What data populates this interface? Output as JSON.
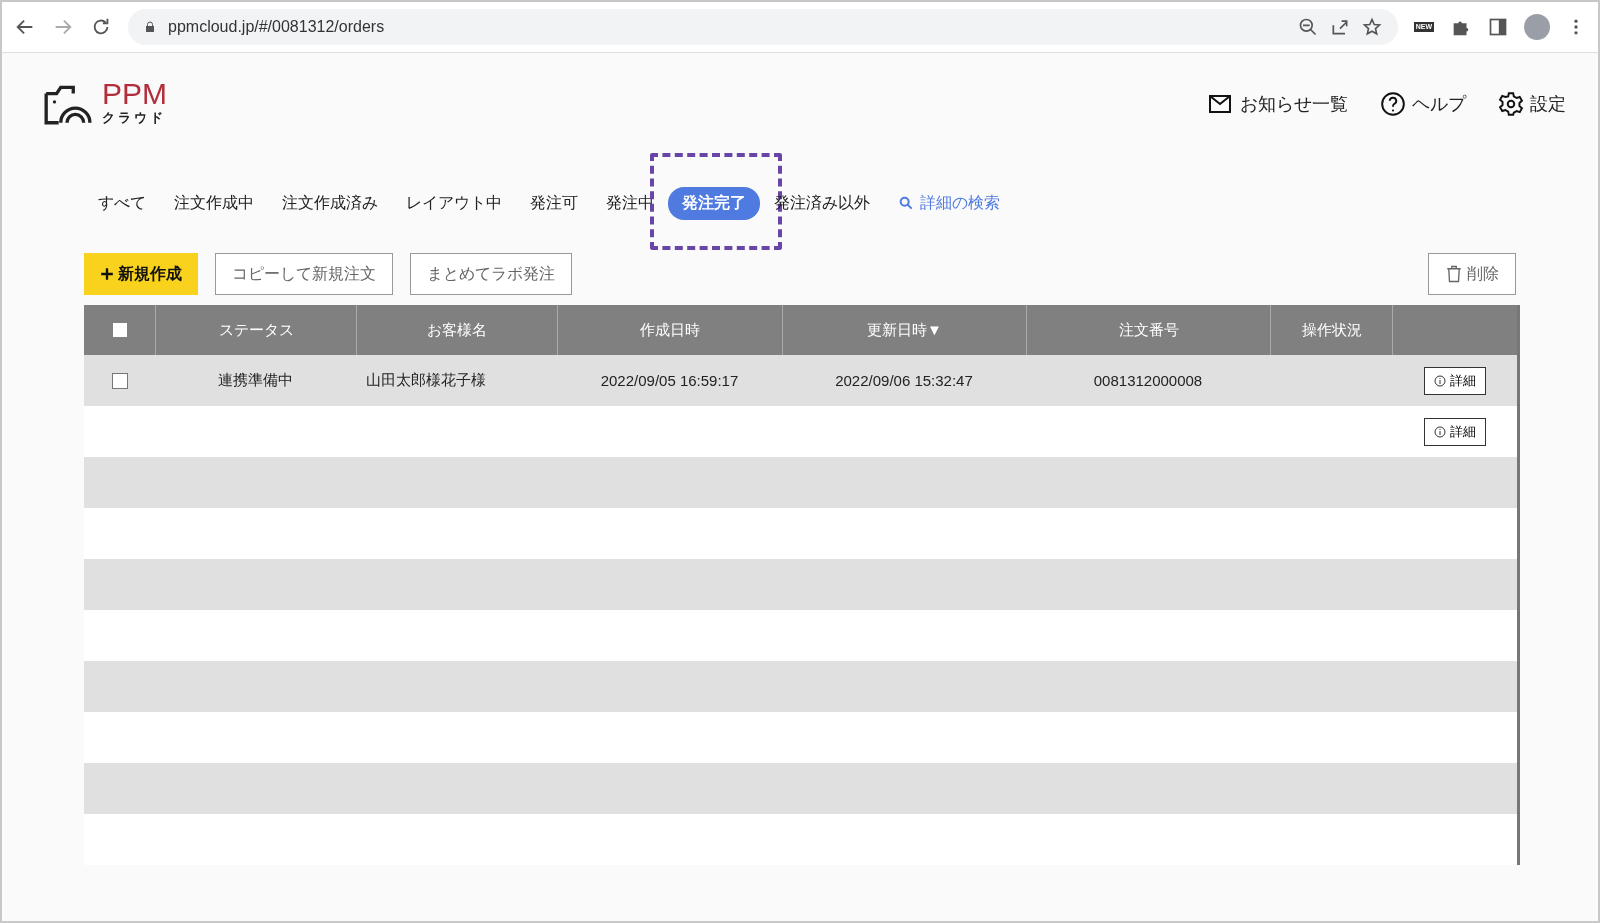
{
  "browser": {
    "url": "ppmcloud.jp/#/0081312/orders",
    "extension_badge": "NEW"
  },
  "header": {
    "logo_text": "PPM",
    "logo_subtext": "クラウド",
    "links": [
      {
        "kind": "mail",
        "label": "お知らせ一覧"
      },
      {
        "kind": "help",
        "label": "ヘルプ"
      },
      {
        "kind": "settings",
        "label": "設定"
      }
    ]
  },
  "tabs": [
    {
      "label": "すべて",
      "selected": false,
      "highlighted": false
    },
    {
      "label": "注文作成中",
      "selected": false,
      "highlighted": false
    },
    {
      "label": "注文作成済み",
      "selected": false,
      "highlighted": false
    },
    {
      "label": "レイアウト中",
      "selected": false,
      "highlighted": false
    },
    {
      "label": "発注可",
      "selected": false,
      "highlighted": false
    },
    {
      "label": "発注中",
      "selected": false,
      "highlighted": false
    },
    {
      "label": "発注完了",
      "selected": true,
      "highlighted": true
    },
    {
      "label": "発注済み以外",
      "selected": false,
      "highlighted": false
    }
  ],
  "search_link": "詳細の検索",
  "toolbar": {
    "buttons": [
      {
        "kind": "primary",
        "label": "新規作成"
      },
      {
        "kind": "outline",
        "label": "コピーして新規注文"
      },
      {
        "kind": "outline",
        "label": "まとめてラボ発注"
      }
    ],
    "delete_button": "削除"
  },
  "table": {
    "select_all_checked": false,
    "columns": [
      "ステータス",
      "お客様名",
      "作成日時",
      "更新日時▼",
      "注文番号",
      "操作状況"
    ],
    "rows": [
      {
        "checked": false,
        "status": "連携準備中",
        "customer": "山田太郎様花子様",
        "created": "2022/09/05 16:59:17",
        "updated": "2022/09/06 15:32:47",
        "order_no": "0081312000008",
        "operation": "",
        "detail": "詳細"
      },
      {
        "detail": "詳細"
      }
    ]
  }
}
